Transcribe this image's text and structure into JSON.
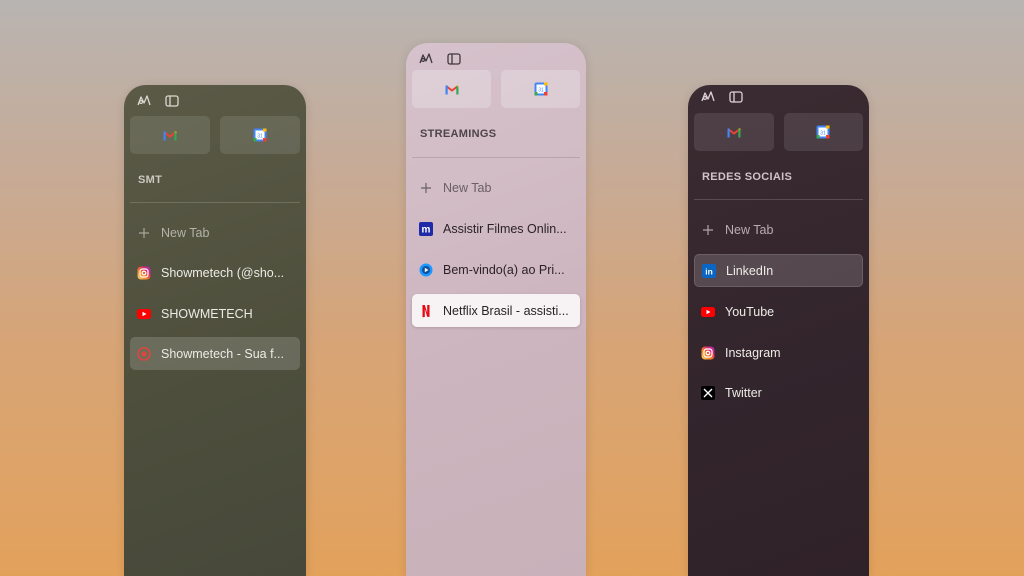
{
  "panels": {
    "smt": {
      "section_title": "SMT",
      "new_tab": "New Tab",
      "tabs": [
        "Showmetech (@sho...",
        "SHOWMETECH",
        "Showmetech - Sua f..."
      ]
    },
    "streamings": {
      "section_title": "STREAMINGS",
      "new_tab": "New Tab",
      "tabs": [
        "Assistir Filmes Onlin...",
        "Bem-vindo(a) ao Pri...",
        "Netflix Brasil - assisti..."
      ]
    },
    "redes": {
      "section_title": "REDES SOCIAIS",
      "new_tab": "New Tab",
      "tabs": [
        "LinkedIn",
        "YouTube",
        "Instagram",
        "Twitter"
      ]
    }
  },
  "icons": {
    "workspace": "workspace-icon",
    "sidebar": "sidebar-toggle-icon",
    "gmail": "gmail-icon",
    "calendar": "google-calendar-icon",
    "plus": "plus-icon"
  },
  "colors": {
    "smt_panel": "#4e4f3c",
    "streamings_panel": "#cdb5bf",
    "redes_panel": "#33252c"
  }
}
